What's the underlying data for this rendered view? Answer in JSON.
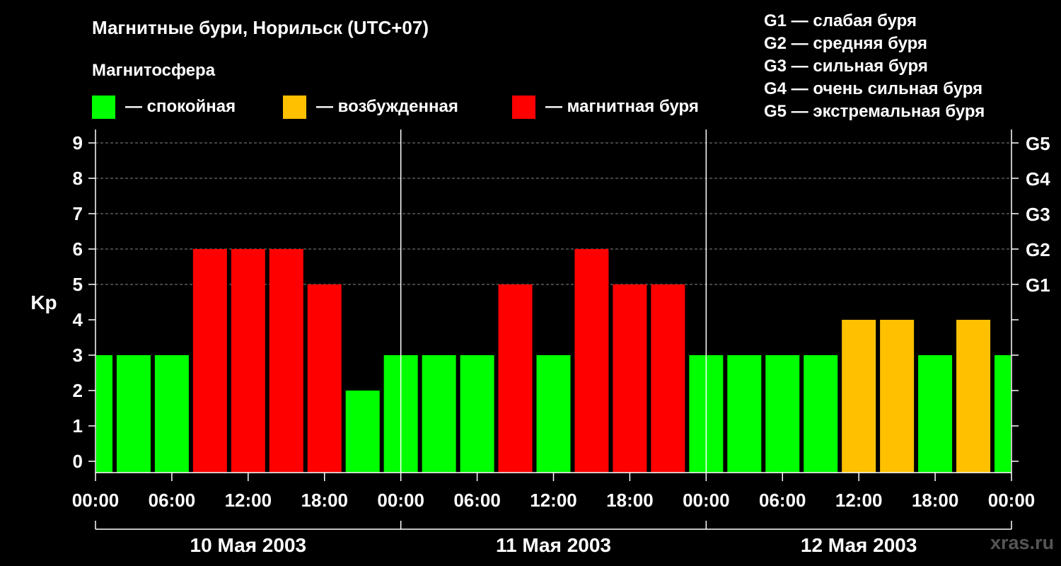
{
  "header": {
    "title": "Магнитные бури, Норильск (UTC+07)",
    "subtitle": "Магнитосфера"
  },
  "legend": [
    {
      "label": "— спокойная",
      "color": "#00ff00"
    },
    {
      "label": "— возбужденная",
      "color": "#ffc000"
    },
    {
      "label": "— магнитная буря",
      "color": "#ff0000"
    }
  ],
  "g_legend": [
    "G1 — слабая буря",
    "G2 — средняя буря",
    "G3 — сильная буря",
    "G4 — очень сильная буря",
    "G5 — экстремальная буря"
  ],
  "watermark": "xras.ru",
  "chart_data": {
    "type": "bar",
    "ylabel": "Kp",
    "ylim": [
      0,
      9
    ],
    "yticks": [
      0,
      1,
      2,
      3,
      4,
      5,
      6,
      7,
      8,
      9
    ],
    "right_axis_labels": [
      {
        "kp": 5,
        "label": "G1"
      },
      {
        "kp": 6,
        "label": "G2"
      },
      {
        "kp": 7,
        "label": "G3"
      },
      {
        "kp": 8,
        "label": "G4"
      },
      {
        "kp": 9,
        "label": "G5"
      }
    ],
    "grid": "horizontal dashed at Kp 5–9",
    "xtick_labels": [
      "00:00",
      "06:00",
      "12:00",
      "18:00",
      "00:00",
      "06:00",
      "12:00",
      "18:00",
      "00:00",
      "06:00",
      "12:00",
      "18:00",
      "00:00"
    ],
    "days": [
      "10 Мая 2003",
      "11 Мая 2003",
      "12 Мая 2003"
    ],
    "bar_hours": [
      0,
      3,
      6,
      9,
      12,
      15,
      18,
      21,
      24,
      27,
      30,
      33,
      36,
      39,
      42,
      45,
      48,
      51,
      54,
      57,
      60,
      63,
      66,
      69,
      72
    ],
    "values": [
      3,
      3,
      3,
      6,
      6,
      6,
      5,
      2,
      3,
      3,
      3,
      5,
      3,
      6,
      5,
      5,
      3,
      3,
      3,
      3,
      4,
      4,
      3,
      4,
      3
    ],
    "levels": [
      "quiet",
      "quiet",
      "quiet",
      "storm",
      "storm",
      "storm",
      "storm",
      "quiet",
      "quiet",
      "quiet",
      "quiet",
      "storm",
      "quiet",
      "storm",
      "storm",
      "storm",
      "quiet",
      "quiet",
      "quiet",
      "quiet",
      "active",
      "active",
      "quiet",
      "active",
      "quiet"
    ],
    "level_colors": {
      "quiet": "#00ff00",
      "active": "#ffc000",
      "storm": "#ff0000"
    }
  }
}
